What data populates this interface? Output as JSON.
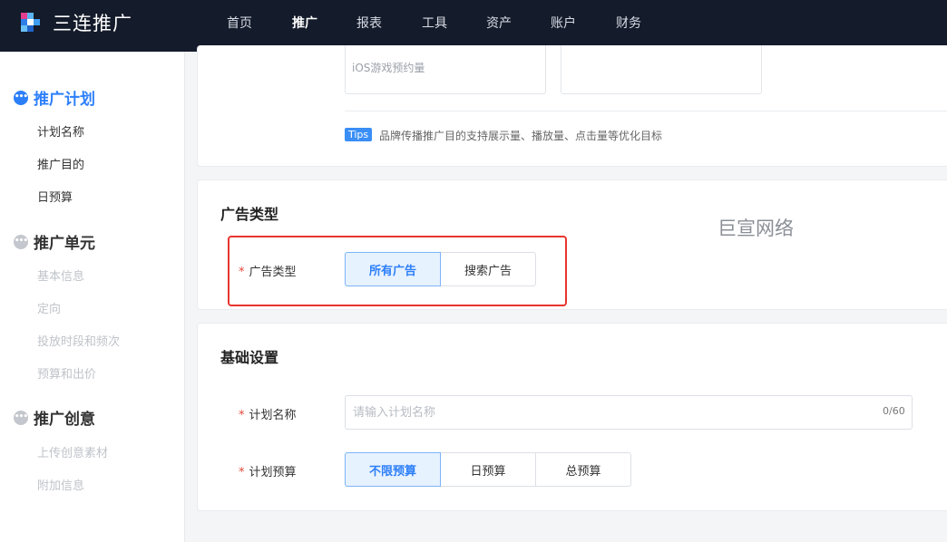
{
  "header": {
    "brand": "三连推广",
    "logo_icon": "pixel-logo-icon",
    "nav": [
      {
        "label": "首页"
      },
      {
        "label": "推广"
      },
      {
        "label": "报表"
      },
      {
        "label": "工具"
      },
      {
        "label": "资产"
      },
      {
        "label": "账户"
      },
      {
        "label": "财务"
      }
    ],
    "active_nav": "推广"
  },
  "sidebar": {
    "groups": [
      {
        "label": "推广计划",
        "icon": "ellipsis-circle-icon",
        "active": true,
        "items": [
          "计划名称",
          "推广目的",
          "日预算"
        ]
      },
      {
        "label": "推广单元",
        "icon": "ellipsis-circle-icon",
        "active": false,
        "items": [
          "基本信息",
          "定向",
          "投放时段和频次",
          "预算和出价"
        ]
      },
      {
        "label": "推广创意",
        "icon": "ellipsis-circle-icon",
        "active": false,
        "items": [
          "上传创意素材",
          "附加信息"
        ]
      }
    ]
  },
  "purpose": {
    "option_text": "iOS游戏预约量",
    "tips_badge": "Tips",
    "tips_text": "品牌传播推广目的支持展示量、播放量、点击量等优化目标"
  },
  "ad_type": {
    "section_title": "广告类型",
    "field_label": "广告类型",
    "options": [
      "所有广告",
      "搜索广告"
    ],
    "selected": "所有广告",
    "watermark": "巨宣网络"
  },
  "basic": {
    "section_title": "基础设置",
    "name_label": "计划名称",
    "name_placeholder": "请输入计划名称",
    "name_counter": "0/60",
    "budget_label": "计划预算",
    "budget_options": [
      "不限预算",
      "日预算",
      "总预算"
    ],
    "budget_selected": "不限预算"
  },
  "colors": {
    "nav_bg": "#141b2a",
    "accent": "#2d7ff9",
    "highlight_border": "#e8352f",
    "required_mark": "#e5483a"
  }
}
